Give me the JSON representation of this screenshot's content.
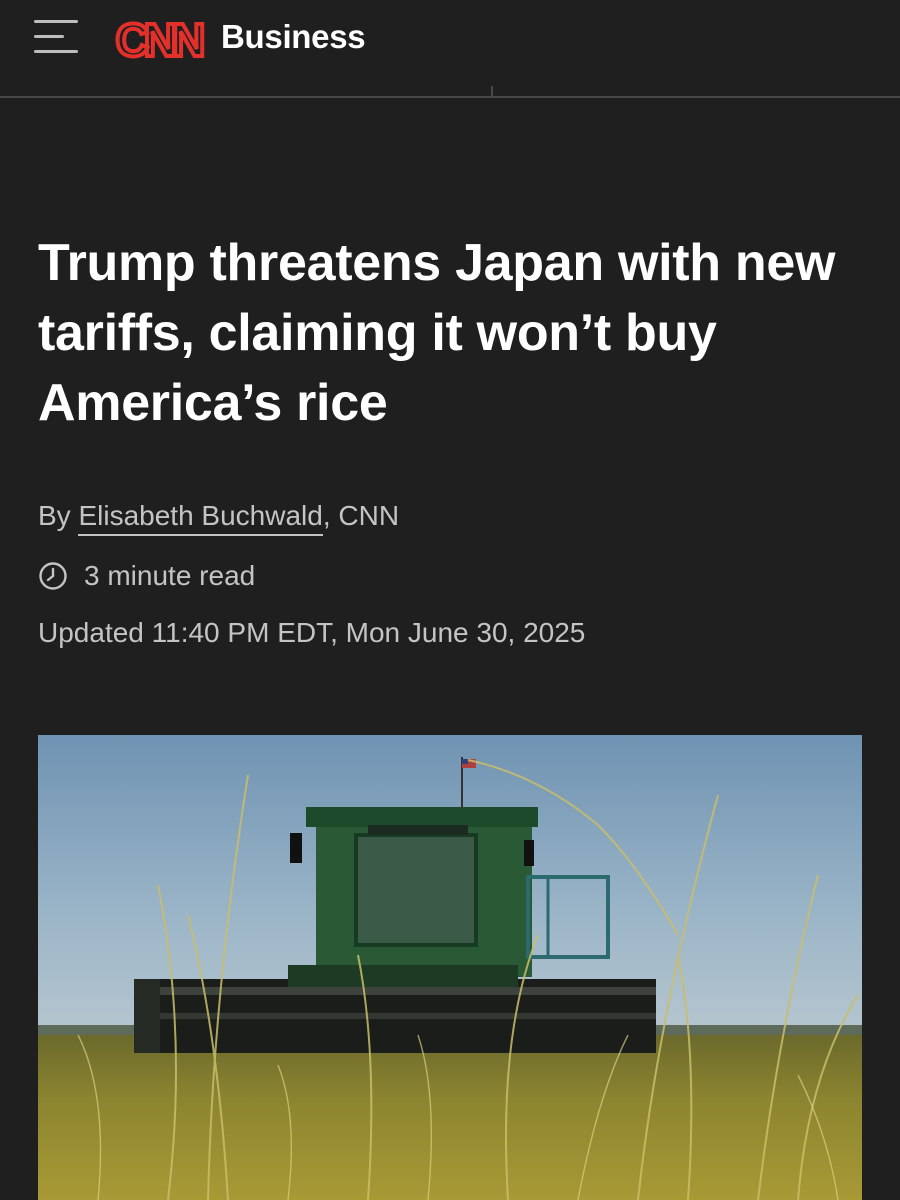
{
  "header": {
    "logo_text": "CNN",
    "section": "Business",
    "brand_color": "#cc0000",
    "icons": [
      "menu-icon",
      "cnn-logo"
    ]
  },
  "article": {
    "headline": "Trump threatens Japan with new tariffs, claiming it won’t buy America’s rice",
    "byline_prefix": "By",
    "author": "Elisabeth Buchwald",
    "byline_suffix": ", CNN",
    "read_time": "3 minute read",
    "updated": "Updated 11:40 PM EDT, Mon June 30, 2025"
  },
  "colors": {
    "background": "#1f1f1f",
    "text_primary": "#ffffff",
    "text_secondary": "#c4c4c4"
  }
}
